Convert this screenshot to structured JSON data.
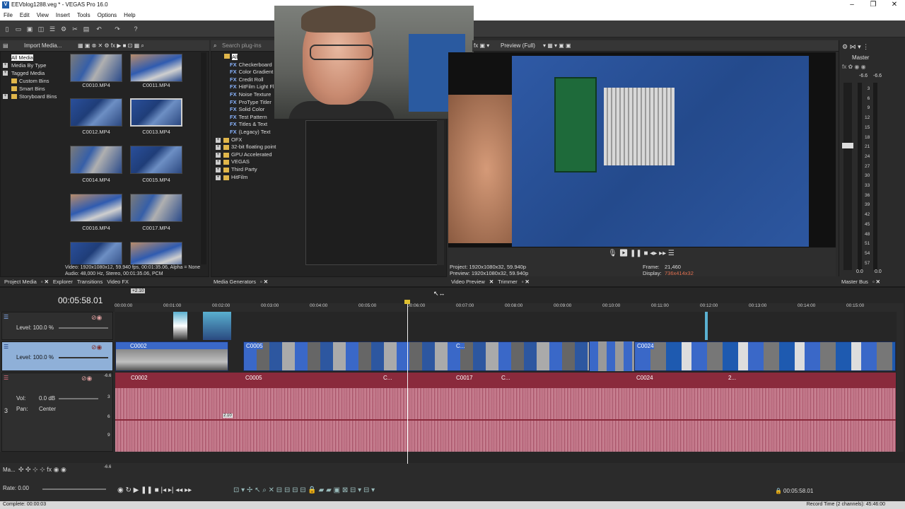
{
  "window": {
    "title": "EEVblog1288.veg * - VEGAS Pro 16.0",
    "icon": "vegas-logo-icon",
    "controls": [
      "–",
      "❐",
      "✕"
    ]
  },
  "menu": [
    "File",
    "Edit",
    "View",
    "Insert",
    "Tools",
    "Options",
    "Help"
  ],
  "project_media": {
    "import_label": "Import Media...",
    "tree": [
      {
        "label": "All Media",
        "selected": true
      },
      {
        "label": "Media By Type"
      },
      {
        "label": "Tagged Media"
      },
      {
        "label": "Custom Bins"
      },
      {
        "label": "Smart Bins"
      },
      {
        "label": "Storyboard Bins"
      }
    ],
    "thumbnails": [
      "C0010.MP4",
      "C0011.MP4",
      "C0012.MP4",
      "C0013.MP4",
      "C0014.MP4",
      "C0015.MP4",
      "C0016.MP4",
      "C0017.MP4"
    ],
    "info_video": "Video: 1920x1080x12, 59.940 fps, 00:01:35.06, Alpha = None",
    "info_audio": "Audio: 48,000 Hz, Stereo, 00:01:35.06, PCM"
  },
  "left_tabs": [
    "Project Media",
    "Explorer",
    "Transitions",
    "Video FX"
  ],
  "plugins": {
    "search_placeholder": "Search plug-ins",
    "root": "All",
    "items": [
      "Checkerboard",
      "Color Gradient",
      "Credit Roll",
      "HitFilm Light Fla",
      "Noise Texture",
      "ProType Titler",
      "Solid Color",
      "Test Pattern",
      "Titles & Text",
      "(Legacy) Text"
    ],
    "groups": [
      "OFX",
      "32-bit floating point",
      "GPU Accelerated",
      "VEGAS",
      "Third Party",
      "HitFilm"
    ],
    "fx_tag": "FX"
  },
  "mid_tabs": [
    "Media Generators"
  ],
  "preview": {
    "quality": "Preview (Full)",
    "project": "Project: 1920x1080x32, 59.940p",
    "preview_res": "Preview: 1920x1080x32, 59.940p",
    "frame_label": "Frame:",
    "frame_value": "21,460",
    "display_label": "Display:",
    "display_value": "736x414x32"
  },
  "preview_tabs": [
    "Video Preview",
    "Trimmer"
  ],
  "master": {
    "title": "Master",
    "levels": [
      "-6.6",
      "-6.6"
    ],
    "scale": [
      "3",
      "6",
      "9",
      "12",
      "15",
      "18",
      "21",
      "24",
      "27",
      "30",
      "33",
      "36",
      "39",
      "42",
      "45",
      "48",
      "51",
      "54",
      "57"
    ],
    "bottom": [
      "0.0",
      "0.0"
    ],
    "tab": "Master Bus"
  },
  "timeline": {
    "timecode": "00:05:58.01",
    "ruler": [
      "00:00:00",
      "00:01:00",
      "00:02:00",
      "00:03:00",
      "00:04:00",
      "00:05:00",
      "00:06:00",
      "00:07:00",
      "00:08:00",
      "00:09:00",
      "00:10:00",
      "00:11:00",
      "00:12:00",
      "00:13:00",
      "00:14:00",
      "00:15:00"
    ],
    "marker": "+2.10",
    "track1": {
      "level_label": "Level: 100.0 %"
    },
    "track2": {
      "level_label": "Level: 100.0 %"
    },
    "track3": {
      "number": "3",
      "vol_label": "Vol:",
      "vol_value": "0.0 dB",
      "pan_label": "Pan:",
      "pan_value": "Center",
      "db_tag": "-6.6"
    },
    "video_clips": [
      "C0002",
      "C0005",
      "C...",
      "C0024"
    ],
    "audio_clips": [
      "C0002",
      "C0005",
      "C...",
      "C0017",
      "C...",
      "C0024",
      "2..."
    ],
    "audio_scale": [
      "3",
      "6",
      "9"
    ],
    "cursor_label": "2.10"
  },
  "bottom": {
    "rate_label": "Rate: 0.00",
    "master_label": "Ma...",
    "master_db": "-6.6",
    "end_timecode": "00:05:58.01"
  },
  "status": {
    "left": "Complete: 00:00:03",
    "right": "Record Time (2 channels): 45:46:00"
  }
}
